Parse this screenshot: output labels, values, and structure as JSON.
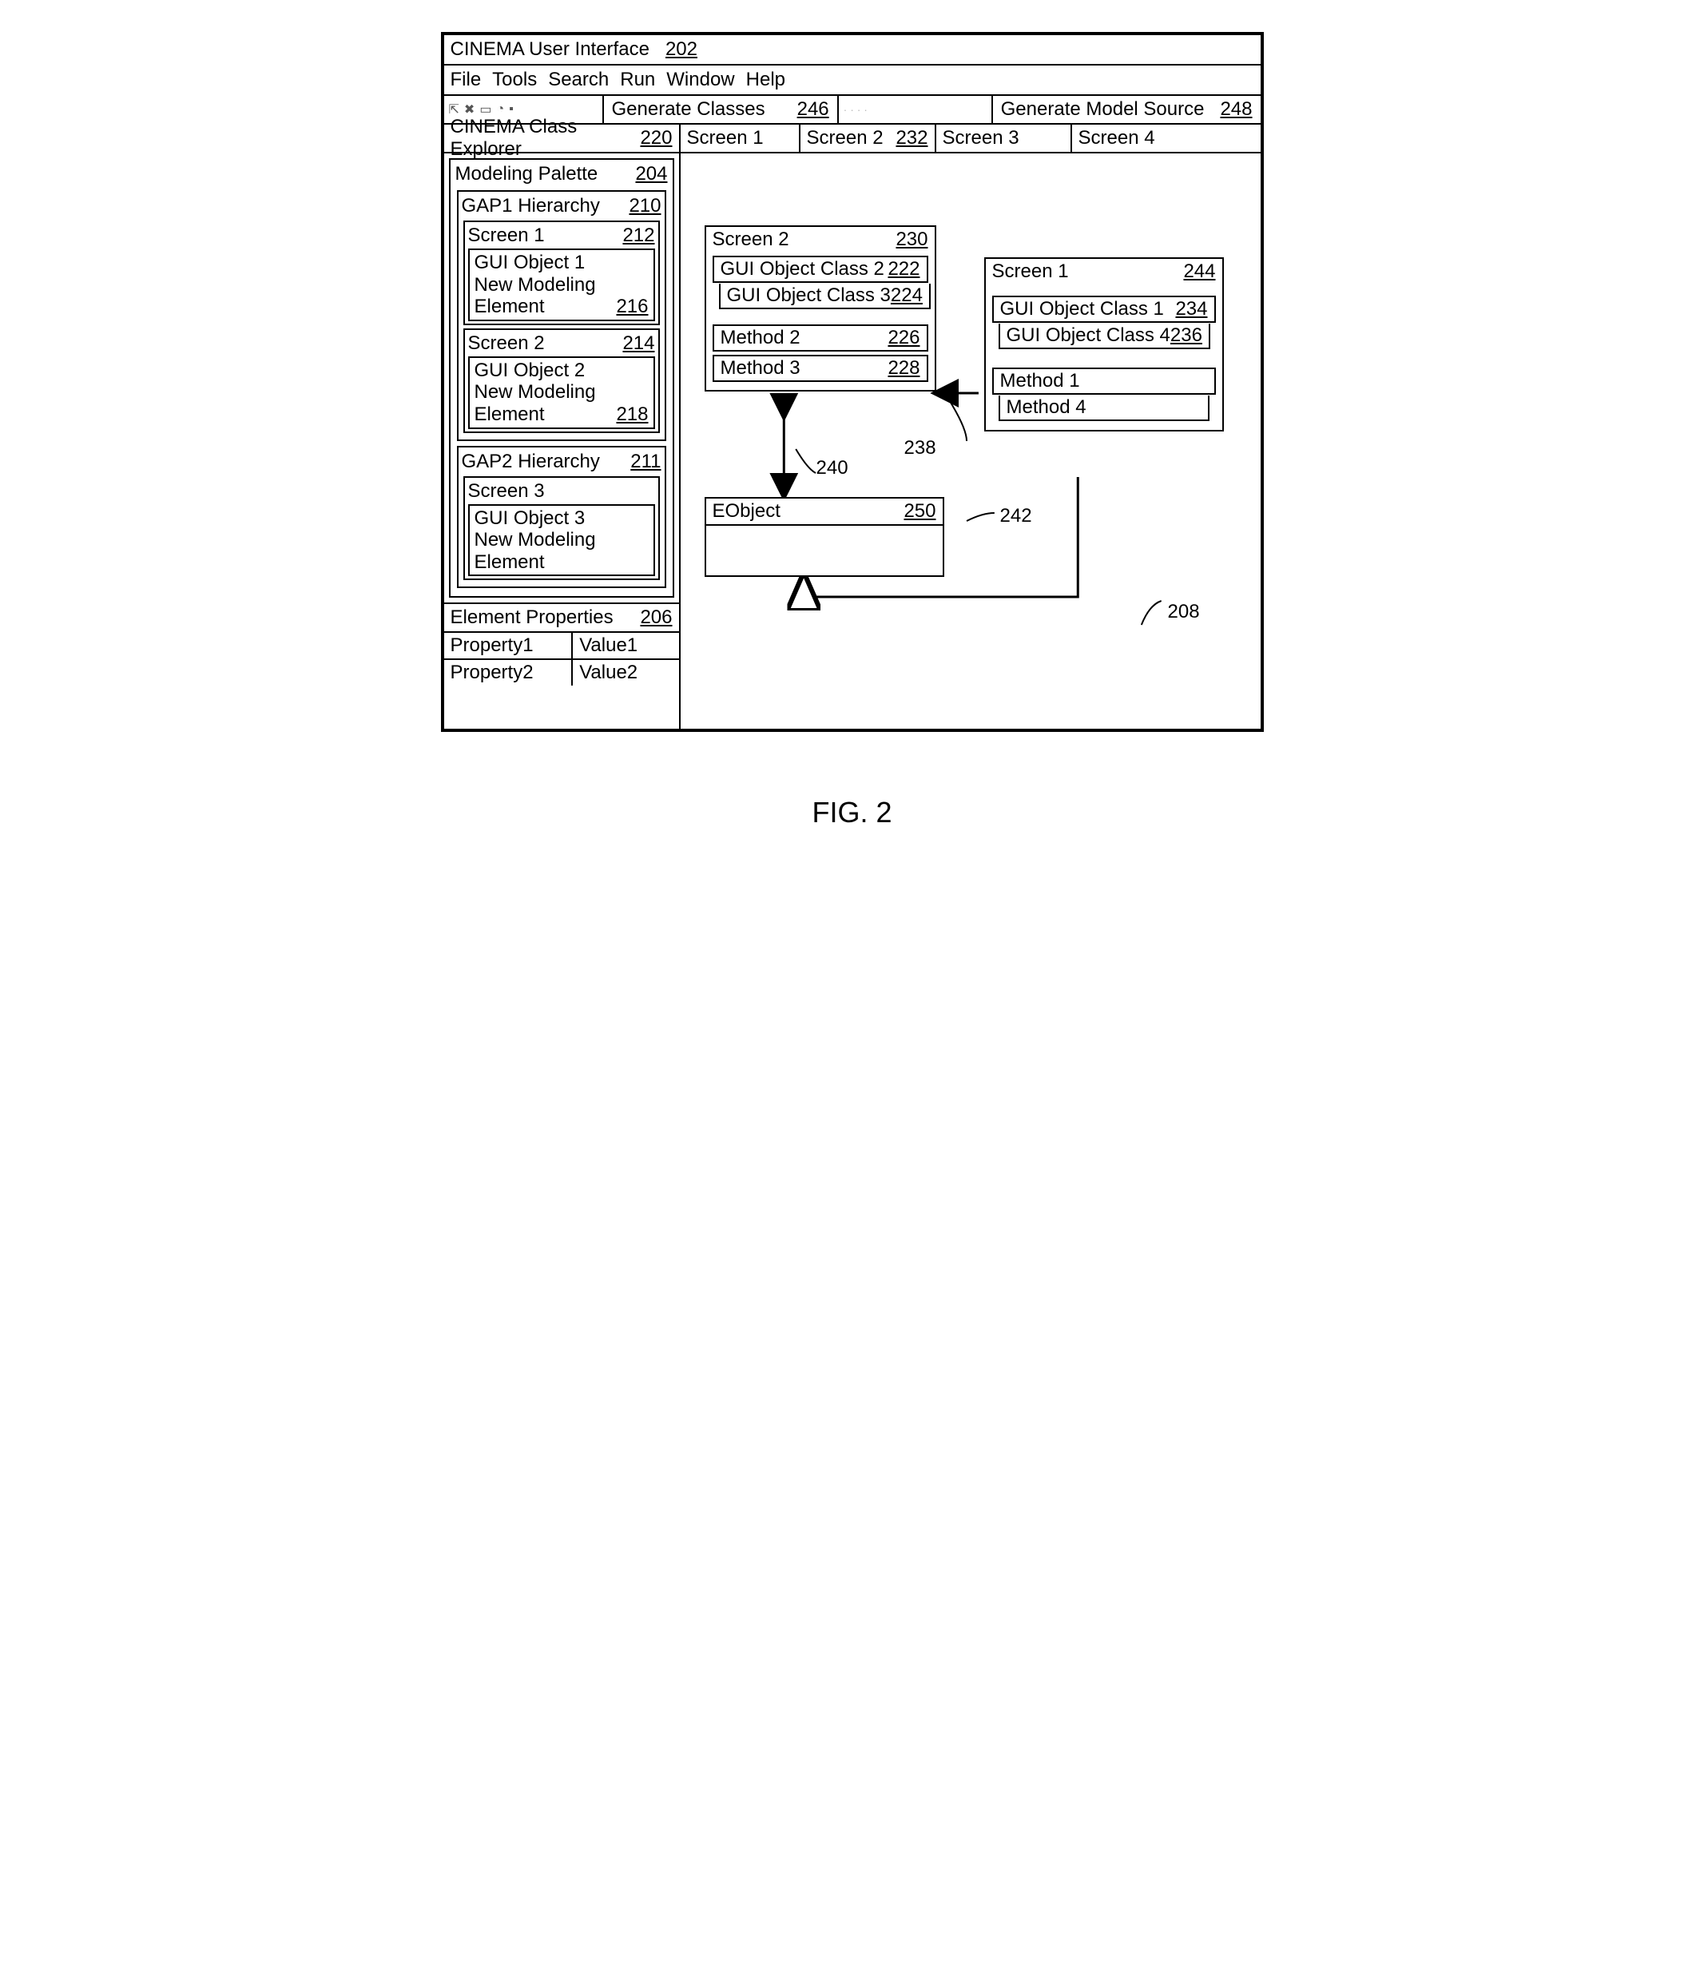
{
  "window": {
    "title": "CINEMA User Interface",
    "ref": "202"
  },
  "menu": [
    "File",
    "Tools",
    "Search",
    "Run",
    "Window",
    "Help"
  ],
  "toolbar": {
    "generateClasses": {
      "label": "Generate Classes",
      "ref": "246"
    },
    "generateModelSource": {
      "label": "Generate Model Source",
      "ref": "248"
    }
  },
  "tabs": {
    "explorer": {
      "label": "CINEMA Class Explorer",
      "ref": "220"
    },
    "screen1": "Screen 1",
    "screen2": {
      "label": "Screen 2",
      "ref": "232"
    },
    "screen3": "Screen 3",
    "screen4": "Screen 4"
  },
  "palette": {
    "title": "Modeling Palette",
    "ref": "204",
    "gap1": {
      "title": "GAP1 Hierarchy",
      "ref": "210",
      "screens": [
        {
          "name": "Screen 1",
          "ref": "212",
          "objLines": [
            "GUI Object 1",
            "New Modeling",
            "Element"
          ],
          "innerRef": "216"
        },
        {
          "name": "Screen 2",
          "ref": "214",
          "objLines": [
            "GUI Object 2",
            "New Modeling",
            "Element"
          ],
          "innerRef": "218"
        }
      ]
    },
    "gap2": {
      "title": "GAP2 Hierarchy",
      "ref": "211",
      "screens": [
        {
          "name": "Screen 3",
          "objLines": [
            "GUI Object 3",
            "New Modeling",
            "Element"
          ]
        }
      ]
    }
  },
  "elementProps": {
    "title": "Element Properties",
    "ref": "206",
    "rows": [
      {
        "k": "Property1",
        "v": "Value1"
      },
      {
        "k": "Property2",
        "v": "Value2"
      }
    ]
  },
  "canvas": {
    "box2": {
      "title": "Screen 2",
      "ref": "230",
      "classes": [
        {
          "label": "GUI Object Class 2",
          "ref": "222"
        },
        {
          "label": "GUI Object Class 3",
          "ref": "224"
        }
      ],
      "methods": [
        {
          "label": "Method 2",
          "ref": "226"
        },
        {
          "label": "Method 3",
          "ref": "228"
        }
      ]
    },
    "box1": {
      "title": "Screen 1",
      "ref": "244",
      "classes": [
        {
          "label": "GUI Object Class 1",
          "ref": "234"
        },
        {
          "label": "GUI Object Class 4",
          "ref": "236"
        }
      ],
      "methods": [
        {
          "label": "Method 1"
        },
        {
          "label": "Method 4"
        }
      ]
    },
    "eobject": {
      "title": "EObject",
      "ref": "250"
    },
    "floatRefs": {
      "r238": "238",
      "r240": "240",
      "r242": "242",
      "r208": "208"
    }
  },
  "figure": "FIG. 2"
}
